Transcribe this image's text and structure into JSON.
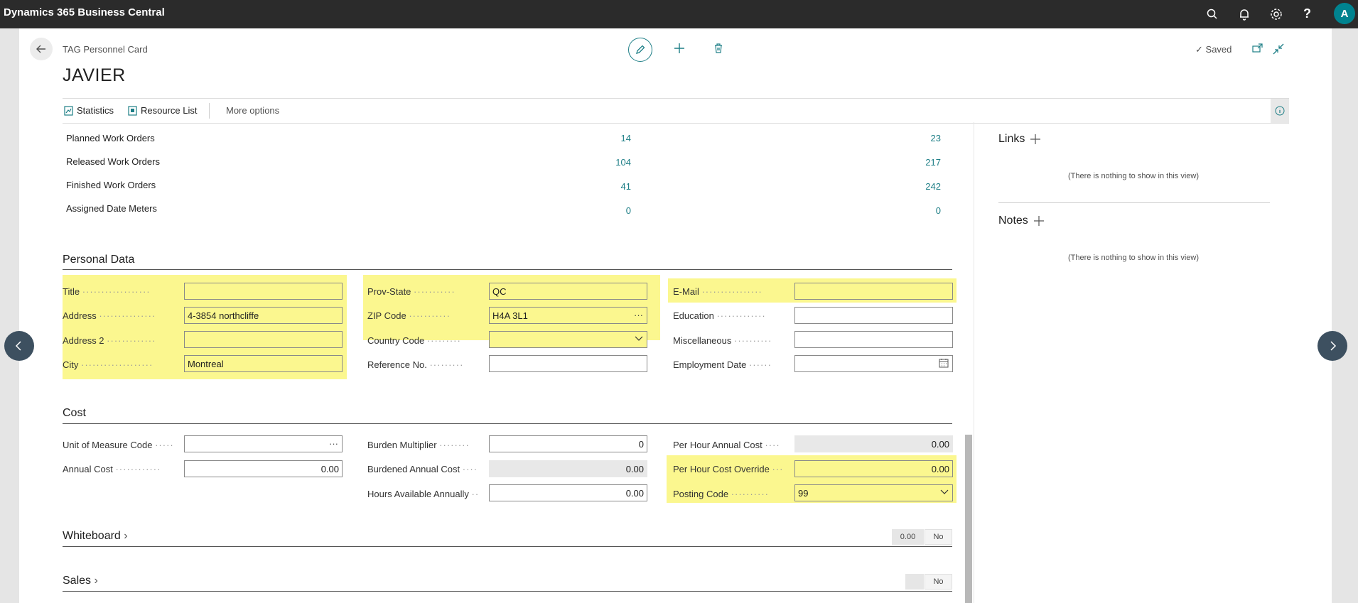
{
  "app": {
    "title": "Dynamics 365 Business Central",
    "avatar_letter": "A"
  },
  "page": {
    "type": "TAG Personnel Card",
    "title": "JAVIER",
    "saved_label": "Saved"
  },
  "actions": {
    "statistics": "Statistics",
    "resource_list": "Resource List",
    "more_options": "More options"
  },
  "stats": {
    "rows": [
      {
        "label": "Planned Work Orders",
        "header": "14",
        "line": "23"
      },
      {
        "label": "Released Work Orders",
        "header": "104",
        "line": "217"
      },
      {
        "label": "Finished Work Orders",
        "header": "41",
        "line": "242"
      },
      {
        "label": "Assigned Date Meters",
        "header": "0",
        "line": "0"
      }
    ]
  },
  "personal_data": {
    "title": "Personal Data",
    "title_label": "Title",
    "title_value": "",
    "address_label": "Address",
    "address_value": "4-3854 northcliffe",
    "address2_label": "Address 2",
    "address2_value": "",
    "city_label": "City",
    "city_value": "Montreal",
    "prov_label": "Prov-State",
    "prov_value": "QC",
    "zip_label": "ZIP Code",
    "zip_value": "H4A 3L1",
    "country_label": "Country Code",
    "country_value": "",
    "ref_label": "Reference No.",
    "ref_value": "",
    "email_label": "E-Mail",
    "email_value": "",
    "education_label": "Education",
    "education_value": "",
    "misc_label": "Miscellaneous",
    "misc_value": "",
    "employment_label": "Employment Date",
    "employment_value": ""
  },
  "cost": {
    "title": "Cost",
    "uom_label": "Unit of Measure Code",
    "uom_value": "",
    "annual_label": "Annual Cost",
    "annual_value": "0.00",
    "burden_label": "Burden Multiplier",
    "burden_value": "0",
    "burdened_label": "Burdened Annual Cost",
    "burdened_value": "0.00",
    "hours_label": "Hours Available Annually",
    "hours_value": "0.00",
    "perhour_label": "Per Hour Annual Cost",
    "perhour_value": "0.00",
    "override_label": "Per Hour Cost Override",
    "override_value": "0.00",
    "posting_label": "Posting Code",
    "posting_value": "99"
  },
  "whiteboard": {
    "title": "Whiteboard",
    "amount": "0.00",
    "flag": "No"
  },
  "sales": {
    "title": "Sales",
    "flag": "No"
  },
  "factbox": {
    "links_title": "Links",
    "links_empty": "(There is nothing to show in this view)",
    "notes_title": "Notes",
    "notes_empty": "(There is nothing to show in this view)"
  },
  "colors": {
    "accent": "#1d7e86",
    "highlight": "#fbf78f",
    "topbar": "#2b2b2b"
  }
}
